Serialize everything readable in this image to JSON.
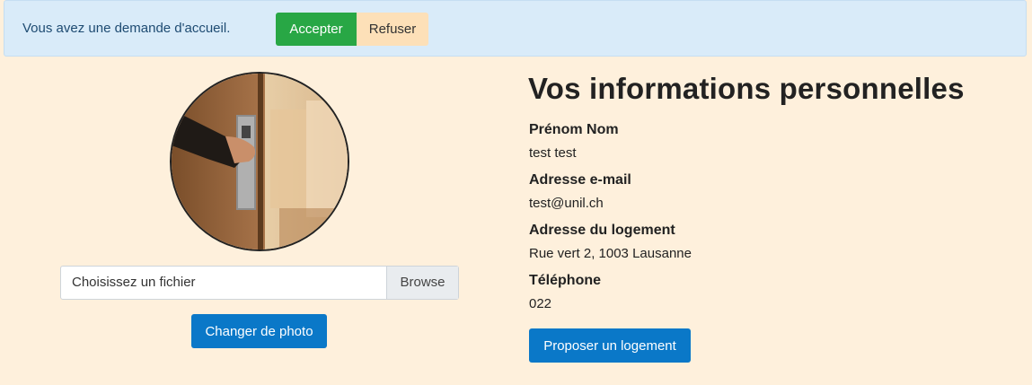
{
  "alert": {
    "message": "Vous avez une demande d'accueil.",
    "accept_label": "Accepter",
    "refuse_label": "Refuser"
  },
  "profile_photo": {
    "upload_placeholder": "Choisissez un fichier",
    "browse_label": "Browse",
    "change_label": "Changer de photo"
  },
  "info": {
    "title": "Vos informations personnelles",
    "fields": [
      {
        "label": "Prénom Nom",
        "value": "test test"
      },
      {
        "label": "Adresse e-mail",
        "value": "test@unil.ch"
      },
      {
        "label": "Adresse du logement",
        "value": "Rue vert 2, 1003 Lausanne"
      },
      {
        "label": "Téléphone",
        "value": "022"
      }
    ],
    "propose_label": "Proposer un logement"
  },
  "colors": {
    "page_bg": "#fef0dc",
    "alert_bg": "#d9ebf9",
    "accept": "#28a745",
    "refuse": "#fde0b8",
    "primary": "#0a78c8"
  }
}
